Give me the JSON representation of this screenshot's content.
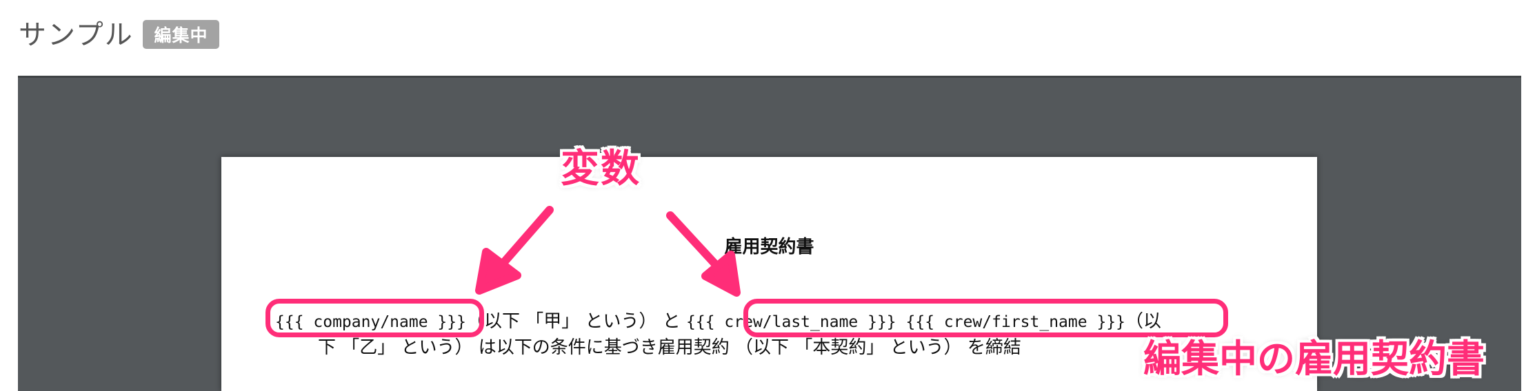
{
  "header": {
    "title": "サンプル",
    "status_badge": "編集中"
  },
  "document": {
    "title": "雇用契約書",
    "line1": {
      "var_company": "{{{ company/name }}}",
      "text_after_company": "（以下 「甲」 という） と ",
      "var_crew": "{{{ crew/last_name }}} {{{ crew/first_name }}}",
      "text_end": "（以"
    },
    "line2": "下 「乙」 という） は以下の条件に基づき雇用契約 （以下 「本契約」 という） を締結"
  },
  "annotations": {
    "variables_label": "変数",
    "editing_doc_label": "編集中の雇用契約書",
    "color": "#ff2d78"
  },
  "colors": {
    "editor_background": "#54585b",
    "badge_background": "#a3a3a3",
    "highlight": "#ff2d78"
  }
}
